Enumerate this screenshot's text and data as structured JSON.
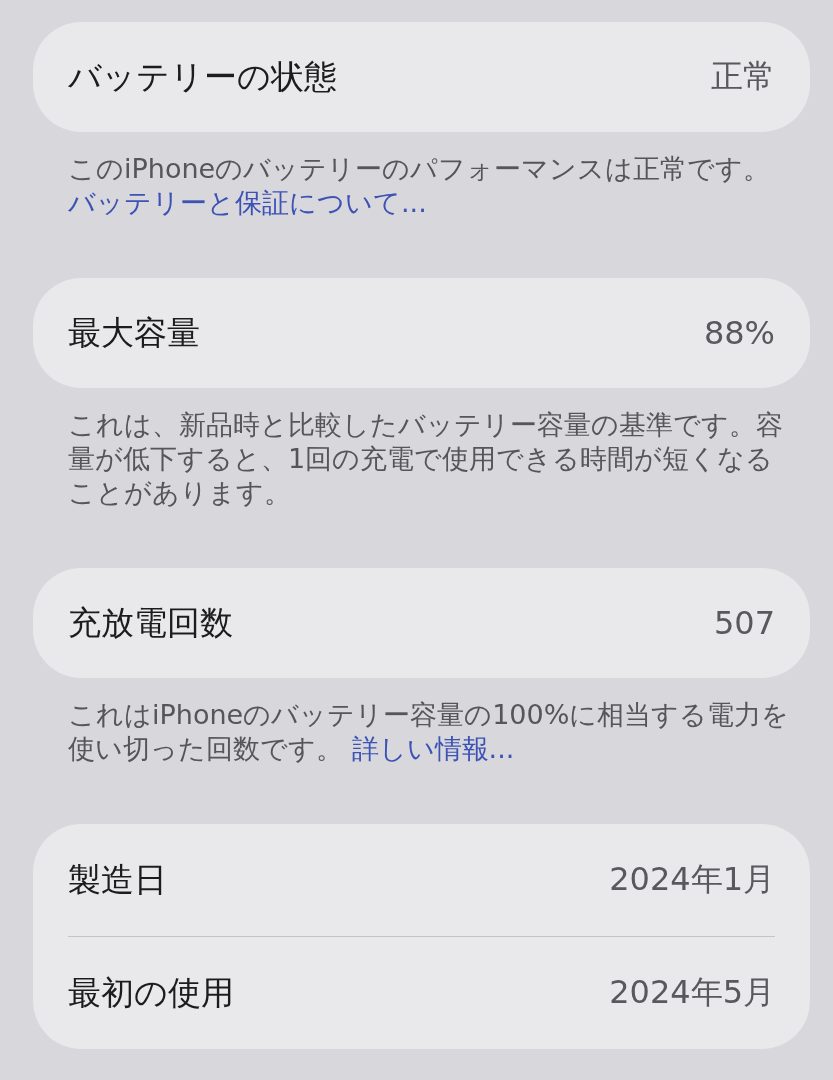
{
  "sections": [
    {
      "rows": [
        {
          "label": "バッテリーの状態",
          "value": "正常"
        }
      ],
      "footer": {
        "text": "このiPhoneのバッテリーのパフォーマンスは正常です。",
        "link": "バッテリーと保証について..."
      }
    },
    {
      "rows": [
        {
          "label": "最大容量",
          "value": "88%"
        }
      ],
      "footer": {
        "text": "これは、新品時と比較したバッテリー容量の基準です。容量が低下すると、1回の充電で使用できる時間が短くなることがあります。"
      }
    },
    {
      "rows": [
        {
          "label": "充放電回数",
          "value": "507"
        }
      ],
      "footer": {
        "text": "これはiPhoneのバッテリー容量の100%に相当する電力を使い切った回数です。",
        "link": "詳しい情報..."
      }
    },
    {
      "rows": [
        {
          "label": "製造日",
          "value": "2024年1月"
        },
        {
          "label": "最初の使用",
          "value": "2024年5月"
        }
      ]
    }
  ]
}
